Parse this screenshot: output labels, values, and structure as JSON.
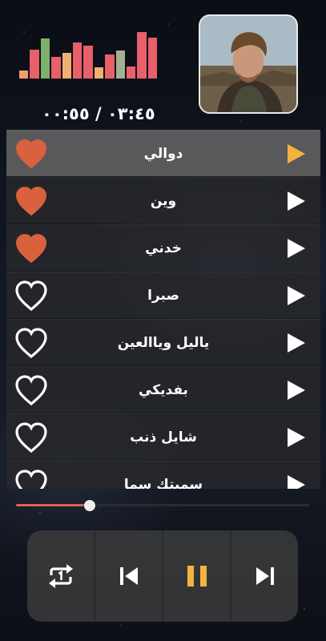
{
  "player": {
    "time_display": "٠٣:٤٥ / ٠٠:٥٥",
    "progress": 0.25,
    "avatar_icon": "artist-photo"
  },
  "equalizer": {
    "levels": [
      0.18,
      0.62,
      0.86,
      0.46,
      0.56,
      0.78,
      0.7,
      0.24,
      0.52,
      0.6,
      0.25,
      1.0,
      0.88
    ],
    "colors": [
      "#f0a070",
      "#e8606a",
      "#7db06a",
      "#e8606a",
      "#f2b070",
      "#e8606a",
      "#e8606a",
      "#f0b070",
      "#e8606a",
      "#a5b090",
      "#e8606a",
      "#e8606a",
      "#e8606a"
    ]
  },
  "playlist": {
    "tracks": [
      {
        "title": "دوالي",
        "favorite": true,
        "active": true
      },
      {
        "title": "وين",
        "favorite": true,
        "active": false
      },
      {
        "title": "خدني",
        "favorite": true,
        "active": false
      },
      {
        "title": "صبرا",
        "favorite": false,
        "active": false
      },
      {
        "title": "ياليل وياالعين",
        "favorite": false,
        "active": false
      },
      {
        "title": "بفديكي",
        "favorite": false,
        "active": false
      },
      {
        "title": "شايل ذنب",
        "favorite": false,
        "active": false
      },
      {
        "title": "سميتك سما",
        "favorite": false,
        "active": false
      }
    ]
  },
  "controls": {
    "buttons": [
      "repeat-one-icon",
      "previous-icon",
      "pause-icon",
      "next-icon"
    ]
  },
  "colors": {
    "accent": "#f2b33f",
    "heart": "#d9613e",
    "progress": "#d9615a"
  }
}
